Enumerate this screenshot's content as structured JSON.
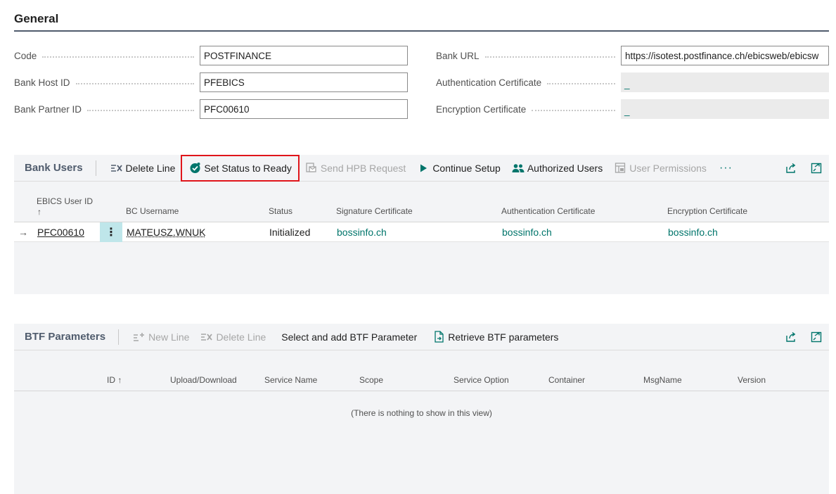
{
  "general": {
    "title": "General",
    "code_label": "Code",
    "code_value": "POSTFINANCE",
    "bank_host_id_label": "Bank Host ID",
    "bank_host_id_value": "PFEBICS",
    "bank_partner_id_label": "Bank Partner ID",
    "bank_partner_id_value": "PFC00610",
    "bank_url_label": "Bank URL",
    "bank_url_value": "https://isotest.postfinance.ch/ebicsweb/ebicsw",
    "auth_cert_label": "Authentication Certificate",
    "auth_cert_value": "_",
    "enc_cert_label": "Encryption Certificate",
    "enc_cert_value": "_"
  },
  "bank_users": {
    "title": "Bank Users",
    "actions": {
      "delete_line": "Delete Line",
      "set_status_ready": "Set Status to Ready",
      "send_hpb": "Send HPB Request",
      "continue_setup": "Continue Setup",
      "authorized_users": "Authorized Users",
      "user_permissions": "User Permissions",
      "more": "···"
    },
    "columns": {
      "ebics_user_id": "EBICS User ID",
      "sort_arrow": "↑",
      "bc_username": "BC Username",
      "status": "Status",
      "signature_cert": "Signature Certificate",
      "auth_cert": "Authentication Certificate",
      "enc_cert": "Encryption Certificate"
    },
    "rows": [
      {
        "indicator": "→",
        "ebics_user_id": "PFC00610",
        "menu": "⋮",
        "bc_username": "MATEUSZ.WNUK",
        "status": "Initialized",
        "signature_cert": "bossinfo.ch",
        "auth_cert": "bossinfo.ch",
        "enc_cert": "bossinfo.ch"
      }
    ]
  },
  "btf_parameters": {
    "title": "BTF Parameters",
    "actions": {
      "new_line": "New Line",
      "delete_line": "Delete Line",
      "select_add": "Select and add BTF Parameter",
      "retrieve": "Retrieve BTF parameters"
    },
    "columns": {
      "id": "ID ↑",
      "upload_download": "Upload/Download",
      "service_name": "Service Name",
      "scope": "Scope",
      "service_option": "Service Option",
      "container": "Container",
      "msgname": "MsgName",
      "version": "Version"
    },
    "empty_message": "(There is nothing to show in this view)"
  },
  "colors": {
    "accent_teal": "#00756b",
    "highlight_border": "#e0151b",
    "part_background": "#f3f4f6"
  },
  "icons": {
    "delete_line": "delete-line-icon",
    "set_status": "check-badge-icon",
    "send_hpb": "send-request-icon",
    "continue_setup": "play-icon",
    "authorized_users": "people-icon",
    "user_permissions": "permissions-icon",
    "share": "share-icon",
    "expand": "expand-icon",
    "new_line": "new-line-icon",
    "retrieve": "document-arrow-icon"
  }
}
